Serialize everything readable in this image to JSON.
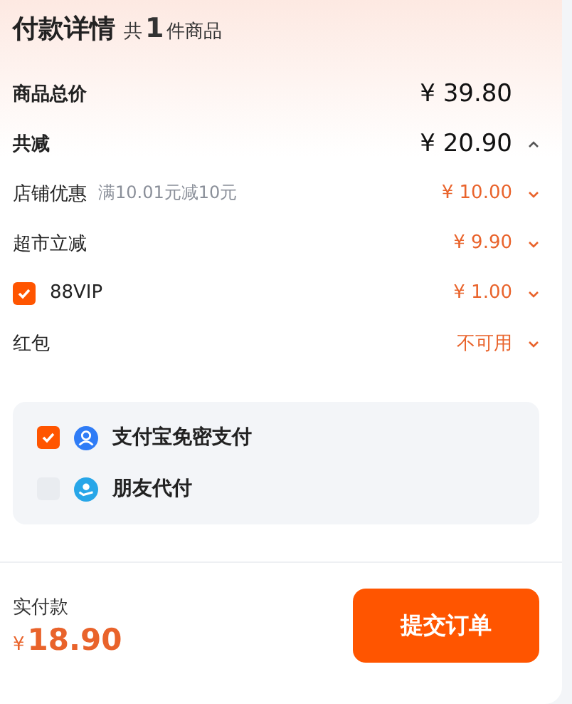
{
  "header": {
    "title": "付款详情",
    "count_prefix": "共",
    "count": "1",
    "count_suffix": "件商品"
  },
  "summary": [
    {
      "kind": "total",
      "label": "商品总价",
      "value": "¥ 39.80"
    },
    {
      "kind": "total",
      "label": "共减",
      "value": "¥ 20.90",
      "expanded": true
    }
  ],
  "discounts": [
    {
      "kind": "plain",
      "label": "店铺优惠",
      "note": "满10.01元减10元",
      "value": "¥ 10.00",
      "expanded": false
    },
    {
      "kind": "plain",
      "label": "超市立减",
      "value": "¥ 9.90",
      "expanded": false
    },
    {
      "kind": "check",
      "label": "88VIP",
      "checked": true,
      "value": "¥ 1.00",
      "expanded": false
    },
    {
      "kind": "plain",
      "label": "红包",
      "value": "不可用",
      "expanded": false
    }
  ],
  "payment_options": [
    {
      "label": "支付宝免密支付",
      "checked": true,
      "kind": "alipay"
    },
    {
      "label": "朋友代付",
      "checked": false,
      "kind": "friend"
    }
  ],
  "footer": {
    "label": "实付款",
    "currency": "¥",
    "amount": "18.90",
    "submit": "提交订单"
  }
}
